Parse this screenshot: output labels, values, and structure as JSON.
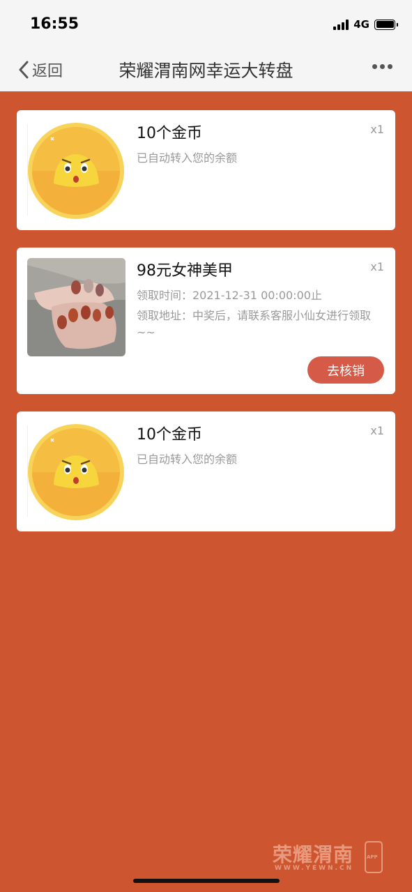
{
  "status_bar": {
    "time": "16:55",
    "network": "4G"
  },
  "nav": {
    "back_label": "返回",
    "title": "荣耀渭南网幸运大转盘"
  },
  "prizes": [
    {
      "title": "10个金币",
      "qty": "x1",
      "lines": [
        "已自动转入您的余额"
      ],
      "image": "gold-coin-icon"
    },
    {
      "title": "98元女神美甲",
      "qty": "x1",
      "lines": [
        "领取时间：2021-12-31 00:00:00止",
        "领取地址：中奖后，请联系客服小仙女进行领取~~"
      ],
      "image": "manicure-photo",
      "action_label": "去核销"
    },
    {
      "title": "10个金币",
      "qty": "x1",
      "lines": [
        "已自动转入您的余额"
      ],
      "image": "gold-coin-icon"
    }
  ],
  "watermark": {
    "text": "荣耀渭南",
    "sub": "WWW.YEWN.CN",
    "badge": "APP"
  },
  "colors": {
    "background": "#cd5631",
    "button": "#d55a48",
    "coin": "#f5b53a"
  }
}
